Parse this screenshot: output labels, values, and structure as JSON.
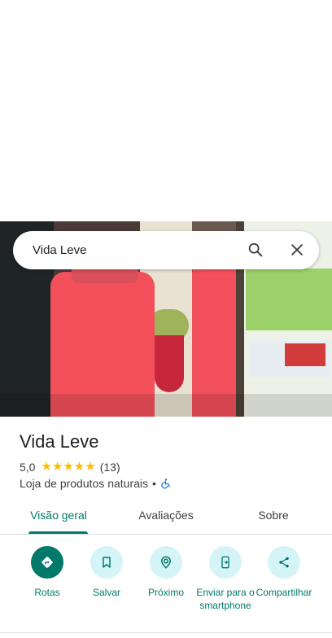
{
  "search": {
    "query": "Vida Leve"
  },
  "place": {
    "name": "Vida Leve",
    "rating_value": "5,0",
    "stars": "★★★★★",
    "review_count": "(13)",
    "category": "Loja de produtos naturais",
    "separator": "•"
  },
  "tabs": [
    {
      "label": "Visão geral",
      "active": true
    },
    {
      "label": "Avaliações",
      "active": false
    },
    {
      "label": "Sobre",
      "active": false
    }
  ],
  "actions": [
    {
      "label": "Rotas",
      "icon": "directions-icon"
    },
    {
      "label": "Salvar",
      "icon": "bookmark-icon"
    },
    {
      "label": "Próximo",
      "icon": "nearby-icon"
    },
    {
      "label": "Enviar para o smartphone",
      "icon": "send-to-phone-icon"
    },
    {
      "label": "Compartilhar",
      "icon": "share-icon"
    }
  ],
  "colors": {
    "accent": "#00796b",
    "action_bg": "#d5f4f8",
    "star": "#fbbc04",
    "accessibility": "#1a73e8"
  }
}
